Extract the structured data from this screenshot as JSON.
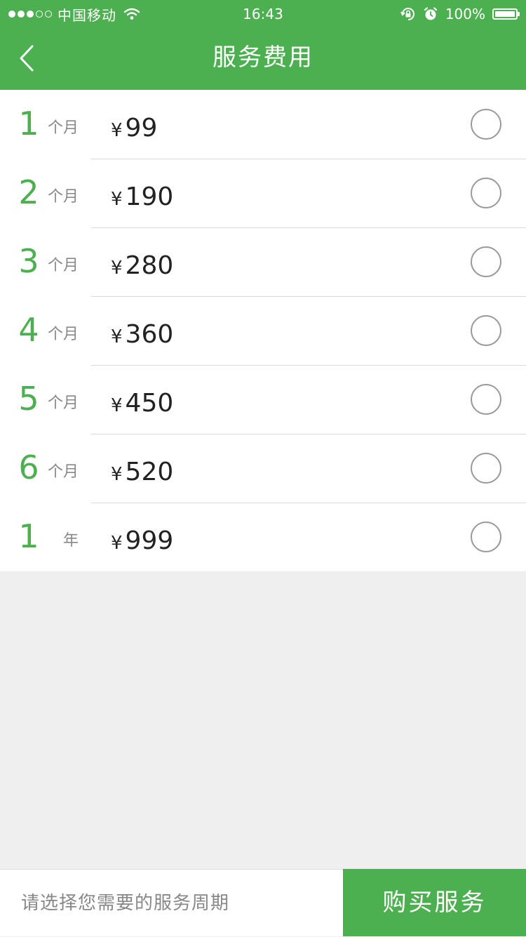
{
  "status_bar": {
    "signal_filled": 3,
    "signal_total": 5,
    "carrier": "中国移动",
    "time": "16:43",
    "battery_percent": "100%",
    "battery_level": 1.0,
    "icons": [
      "wifi-icon",
      "orientation-lock-icon",
      "alarm-icon",
      "battery-icon"
    ]
  },
  "nav": {
    "back_icon": "chevron-left-icon",
    "title": "服务费用"
  },
  "plans": [
    {
      "num": "1",
      "unit": "个月",
      "currency": "¥",
      "price": "99",
      "selected": false
    },
    {
      "num": "2",
      "unit": "个月",
      "currency": "¥",
      "price": "190",
      "selected": false
    },
    {
      "num": "3",
      "unit": "个月",
      "currency": "¥",
      "price": "280",
      "selected": false
    },
    {
      "num": "4",
      "unit": "个月",
      "currency": "¥",
      "price": "360",
      "selected": false
    },
    {
      "num": "5",
      "unit": "个月",
      "currency": "¥",
      "price": "450",
      "selected": false
    },
    {
      "num": "6",
      "unit": "个月",
      "currency": "¥",
      "price": "520",
      "selected": false
    },
    {
      "num": "1",
      "unit": "年",
      "currency": "¥",
      "price": "999",
      "selected": false
    }
  ],
  "bottom": {
    "hint": "请选择您需要的服务周期",
    "buy_label": "购买服务"
  },
  "colors": {
    "accent": "#4caf50",
    "background": "#efefef",
    "divider": "#d9d9d9",
    "secondary_text": "#888888"
  }
}
